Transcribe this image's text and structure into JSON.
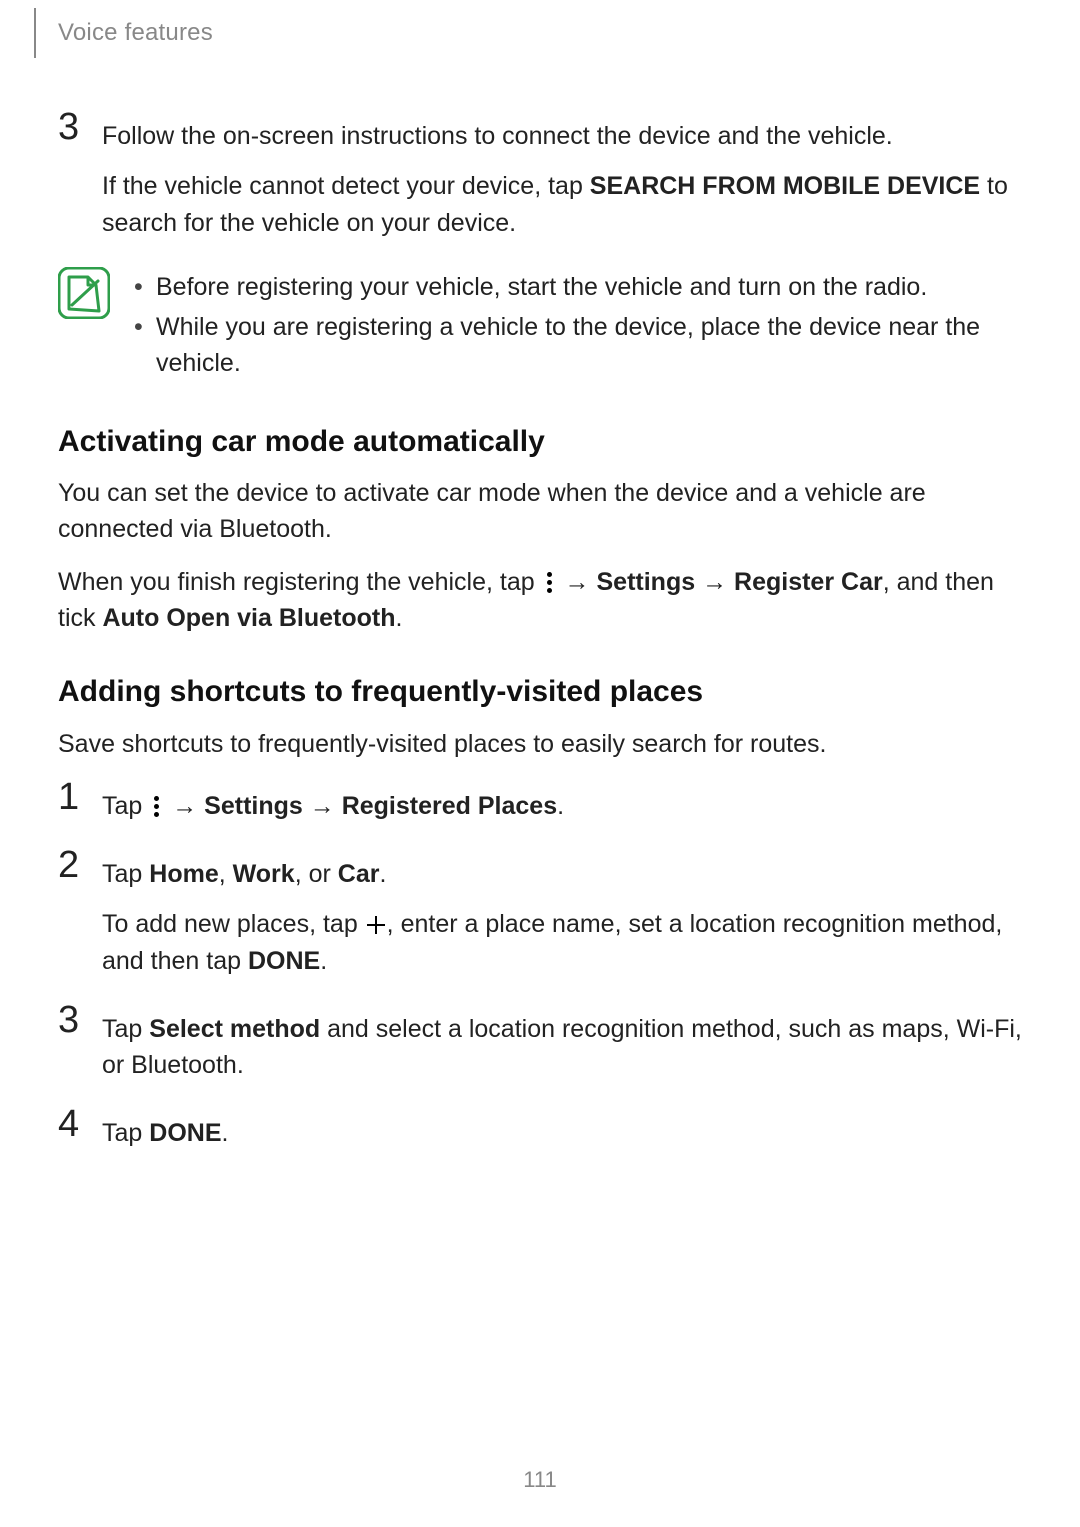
{
  "header": {
    "section": "Voice features"
  },
  "step3": {
    "num": "3",
    "line1": "Follow the on-screen instructions to connect the device and the vehicle.",
    "line2_pre": "If the vehicle cannot detect your device, tap ",
    "line2_bold": "SEARCH FROM MOBILE DEVICE",
    "line2_post": " to search for the vehicle on your device."
  },
  "note": {
    "items": [
      "Before registering your vehicle, start the vehicle and turn on the radio.",
      "While you are registering a vehicle to the device, place the device near the vehicle."
    ]
  },
  "activating": {
    "heading": "Activating car mode automatically",
    "para1": "You can set the device to activate car mode when the device and a vehicle are connected via Bluetooth.",
    "para2_pre": "When you finish registering the vehicle, tap ",
    "arrow": " → ",
    "settings": "Settings",
    "register_car": "Register Car",
    "tick_text": ", and then tick ",
    "auto_open": "Auto Open via Bluetooth",
    "period": "."
  },
  "adding": {
    "heading": "Adding shortcuts to frequently-visited places",
    "intro": "Save shortcuts to frequently-visited places to easily search for routes.",
    "s1": {
      "num": "1",
      "tap": "Tap ",
      "arrow": " → ",
      "settings": "Settings",
      "reg_places": "Registered Places",
      "period": "."
    },
    "s2": {
      "num": "2",
      "pre": "Tap ",
      "home": "Home",
      "comma1": ", ",
      "work": "Work",
      "comma2": ", or ",
      "car": "Car",
      "period": ".",
      "line2_pre": "To add new places, tap ",
      "line2_mid": ", enter a place name, set a location recognition method, and then tap ",
      "done": "DONE",
      "line2_end": "."
    },
    "s3": {
      "num": "3",
      "pre": "Tap ",
      "select_method": "Select method",
      "post": " and select a location recognition method, such as maps, Wi-Fi, or Bluetooth."
    },
    "s4": {
      "num": "4",
      "pre": "Tap ",
      "done": "DONE",
      "post": "."
    }
  },
  "page_number": "111"
}
